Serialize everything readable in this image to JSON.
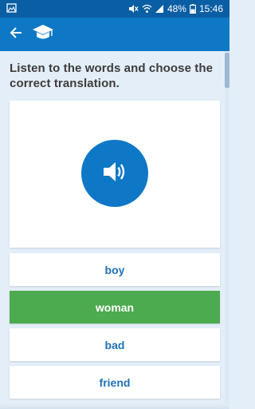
{
  "status_bar": {
    "battery": "48%",
    "time": "15:46",
    "icons": [
      "image-icon",
      "mute-icon",
      "wifi-icon",
      "signal-icon",
      "battery-icon"
    ]
  },
  "app_bar": {
    "back_icon": "arrow-left-icon",
    "logo_icon": "graduation-cap-icon",
    "color": "#0e78c6"
  },
  "exercise": {
    "instruction": "Listen to the words and choose the correct translation.",
    "play_icon": "speaker-icon",
    "options": [
      {
        "label": "boy",
        "selected": false
      },
      {
        "label": "woman",
        "selected": true
      },
      {
        "label": "bad",
        "selected": false
      },
      {
        "label": "friend",
        "selected": false
      }
    ],
    "selected_color": "#4caa4f",
    "option_text_color": "#1f71b8"
  }
}
